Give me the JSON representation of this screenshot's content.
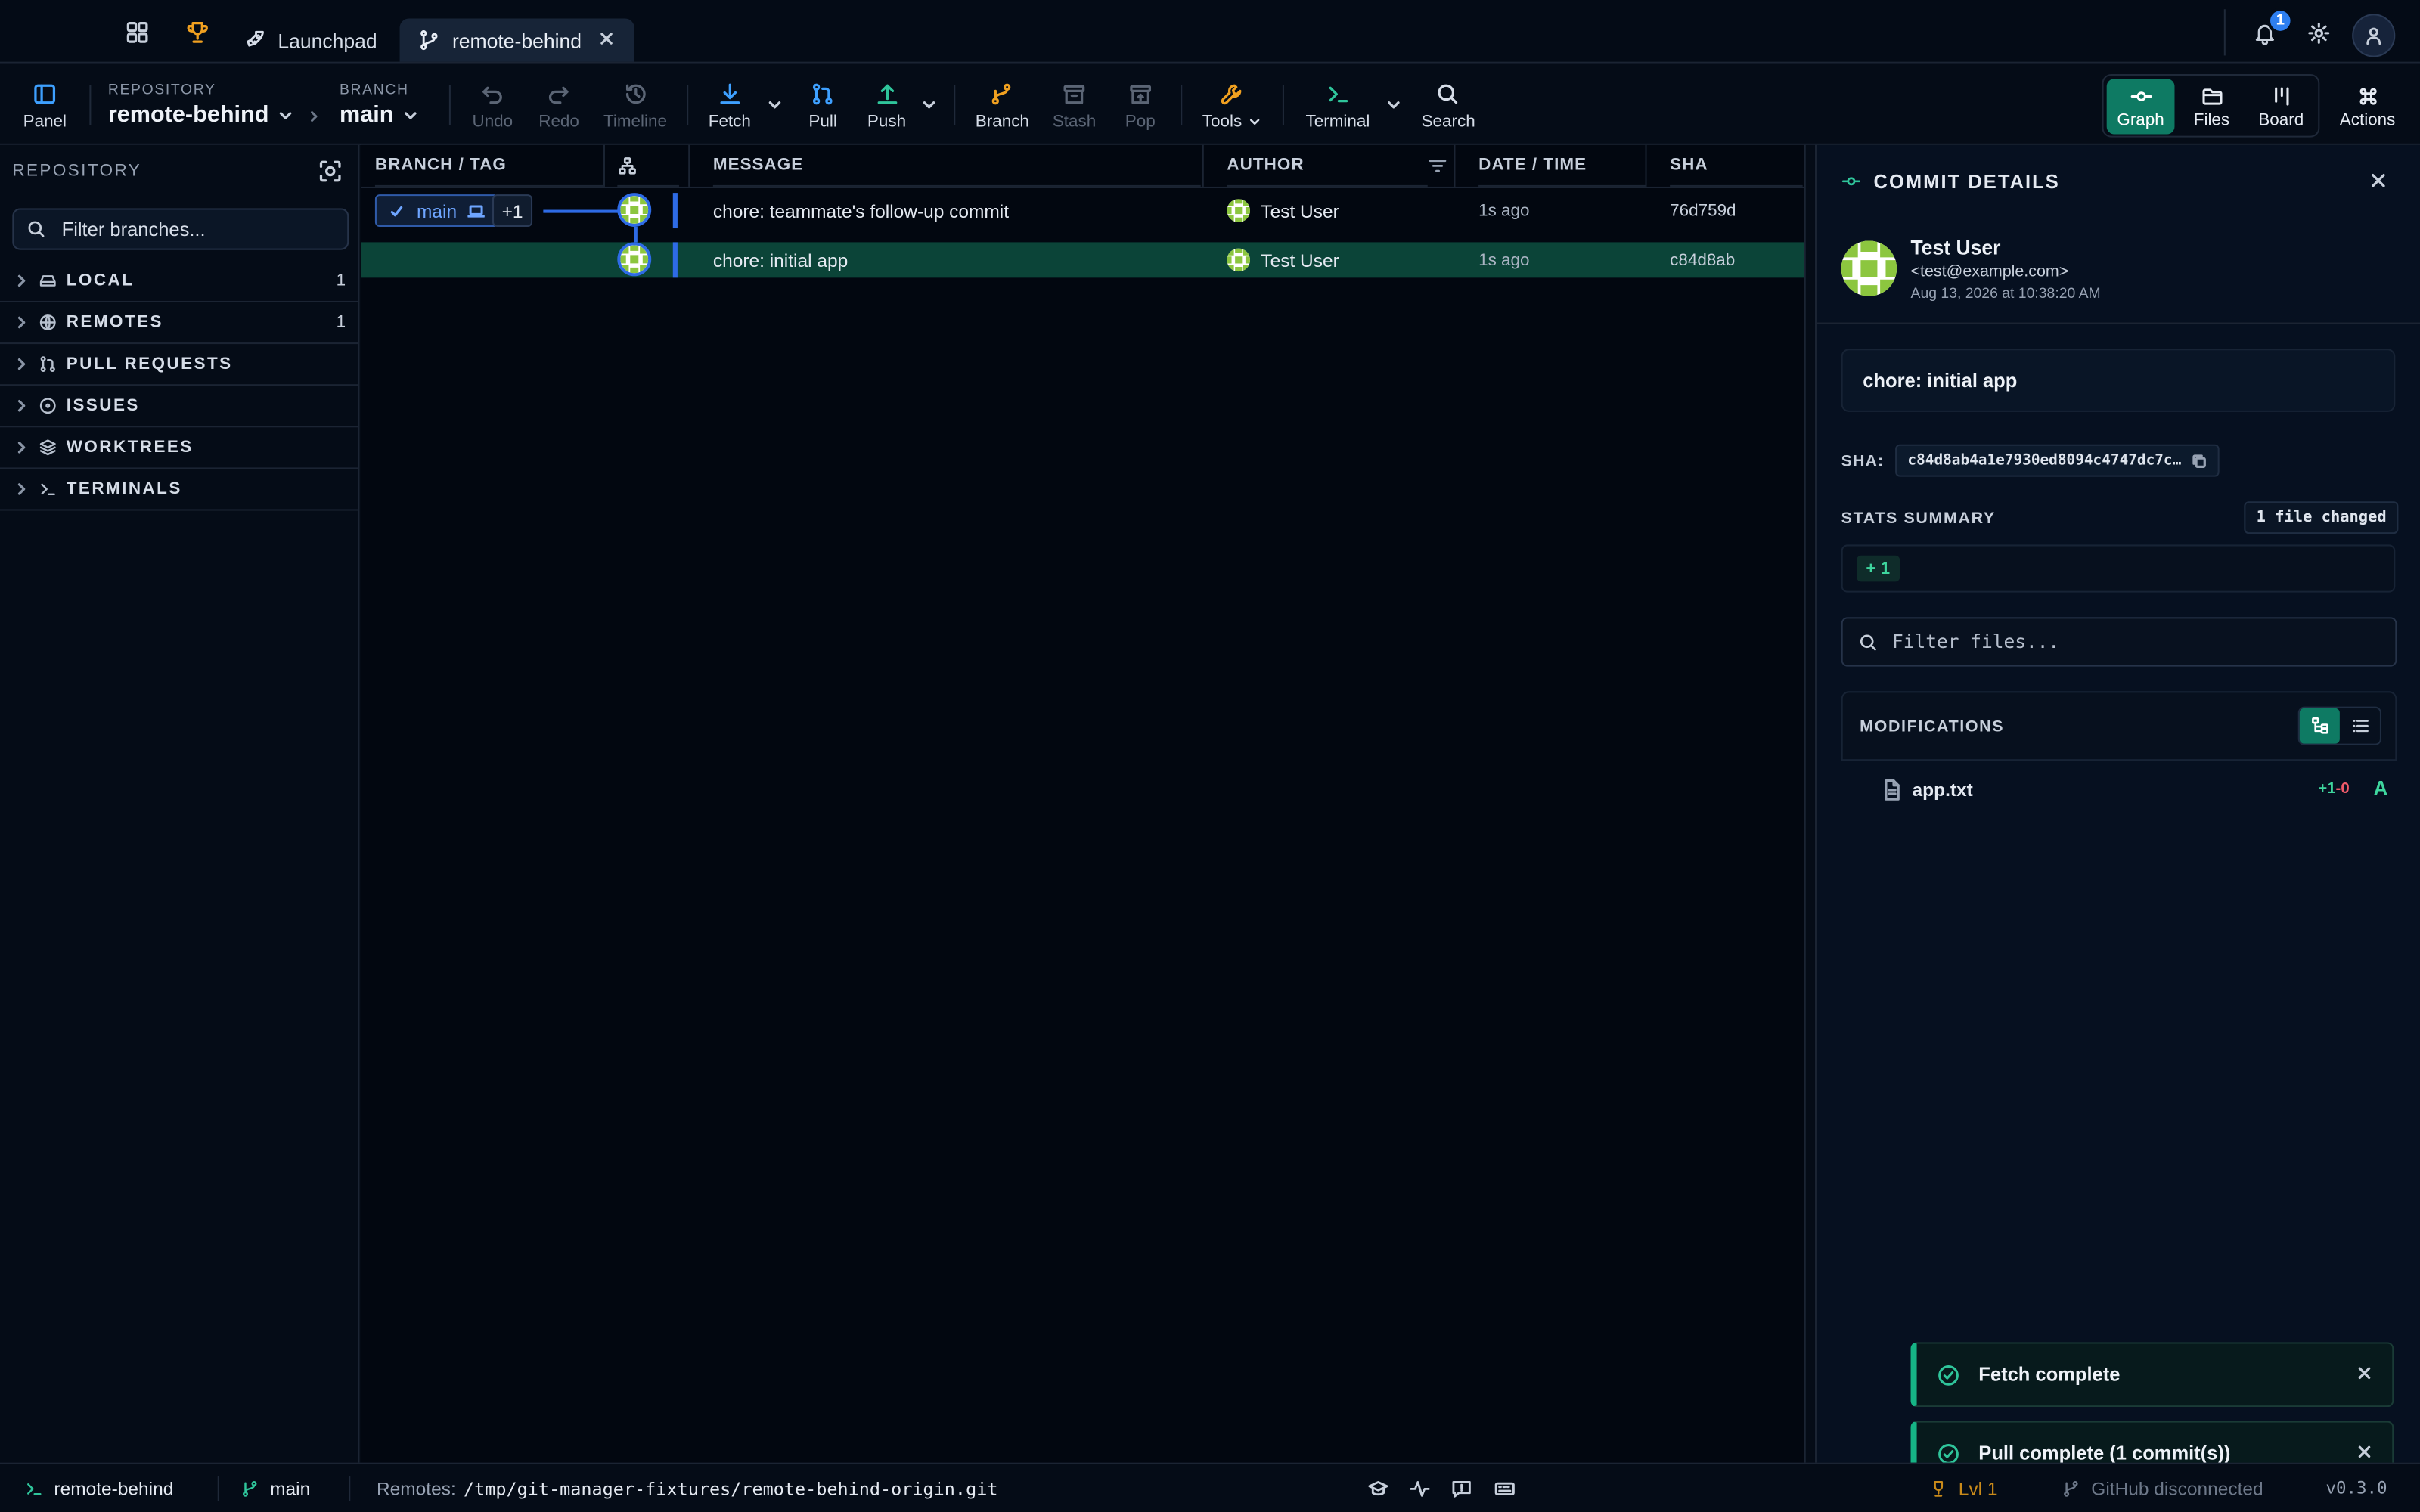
{
  "titlebar": {
    "tabs": [
      {
        "label": "Launchpad",
        "icon": "rocket-icon"
      },
      {
        "label": "remote-behind",
        "icon": "git-branch-icon",
        "active": true
      }
    ],
    "notification_count": "1"
  },
  "toolbar": {
    "panel_label": "Panel",
    "repository_label": "REPOSITORY",
    "repository_value": "remote-behind",
    "branch_label": "BRANCH",
    "branch_value": "main",
    "buttons": {
      "undo": "Undo",
      "redo": "Redo",
      "timeline": "Timeline",
      "fetch": "Fetch",
      "pull": "Pull",
      "push": "Push",
      "branch": "Branch",
      "stash": "Stash",
      "pop": "Pop",
      "tools": "Tools",
      "terminal": "Terminal",
      "search": "Search"
    },
    "views": {
      "graph": "Graph",
      "files": "Files",
      "board": "Board",
      "actions": "Actions"
    }
  },
  "sidebar": {
    "title": "REPOSITORY",
    "filter_placeholder": "Filter branches...",
    "sections": [
      {
        "label": "LOCAL",
        "count": "1",
        "icon": "drive-icon"
      },
      {
        "label": "REMOTES",
        "count": "1",
        "icon": "globe-icon"
      },
      {
        "label": "PULL REQUESTS",
        "count": "",
        "icon": "pull-request-icon"
      },
      {
        "label": "ISSUES",
        "count": "",
        "icon": "issue-icon"
      },
      {
        "label": "WORKTREES",
        "count": "",
        "icon": "layers-icon"
      },
      {
        "label": "TERMINALS",
        "count": "",
        "icon": "terminal-icon"
      }
    ]
  },
  "graph": {
    "columns": {
      "branch_tag": "BRANCH / TAG",
      "message": "MESSAGE",
      "author": "AUTHOR",
      "date_time": "DATE / TIME",
      "sha": "SHA"
    },
    "branch_pill": "main",
    "extra_refs": "+1",
    "commits": [
      {
        "message": "chore: teammate's follow-up commit",
        "author": "Test User",
        "time": "1s ago",
        "sha": "76d759d",
        "selected": false
      },
      {
        "message": "chore: initial app",
        "author": "Test User",
        "time": "1s ago",
        "sha": "c84d8ab",
        "selected": true
      }
    ]
  },
  "details": {
    "title": "COMMIT DETAILS",
    "author_name": "Test User",
    "author_email": "<test@example.com>",
    "date": "Aug 13, 2026 at 10:38:20 AM",
    "message": "chore: initial app",
    "sha_label": "SHA:",
    "sha_value": "c84d8ab4a1e7930ed8094c4747dc7c…",
    "stats_label": "STATS SUMMARY",
    "files_changed": "1 file changed",
    "additions": "+ 1",
    "filter_placeholder": "Filter files...",
    "modifications_label": "MODIFICATIONS",
    "files": [
      {
        "name": "app.txt",
        "added": "+1",
        "removed": "-0",
        "status": "A"
      }
    ]
  },
  "toasts": [
    {
      "text": "Fetch complete"
    },
    {
      "text": "Pull complete (1 commit(s))"
    }
  ],
  "statusbar": {
    "repo": "remote-behind",
    "branch": "main",
    "remotes_label": "Remotes:",
    "remotes_path": "/tmp/git-manager-fixtures/remote-behind-origin.git",
    "level": "Lvl 1",
    "github": "GitHub disconnected",
    "version": "v0.3.0"
  },
  "colors": {
    "accent_green": "#0e7a63",
    "branch_blue": "#2e6be6",
    "selected_row": "#0b4438",
    "add_green": "#3ed69e",
    "remove_red": "#ef5b6a"
  }
}
